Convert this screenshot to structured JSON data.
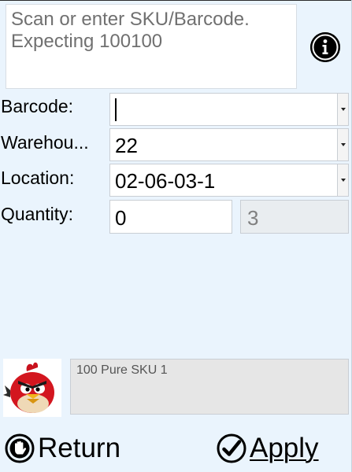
{
  "prompt": {
    "line1": "Scan or enter SKU/Barcode.",
    "line2": "Expecting 100100"
  },
  "info_icon": "info-icon",
  "fields": {
    "barcode": {
      "label": "Barcode:",
      "value": ""
    },
    "warehouse": {
      "label": "Warehou...",
      "value": "22"
    },
    "location": {
      "label": "Location:",
      "value": "02-06-03-1"
    },
    "quantity": {
      "label": "Quantity:",
      "value": "0",
      "expected": "3"
    }
  },
  "product": {
    "image_icon": "angry-bird-icon",
    "description": "100 Pure SKU 1"
  },
  "buttons": {
    "return_label": "Return",
    "apply_label": "Apply"
  },
  "colors": {
    "background": "#eaf4fd",
    "readonly": "#e9edf0",
    "text": "#000000"
  }
}
